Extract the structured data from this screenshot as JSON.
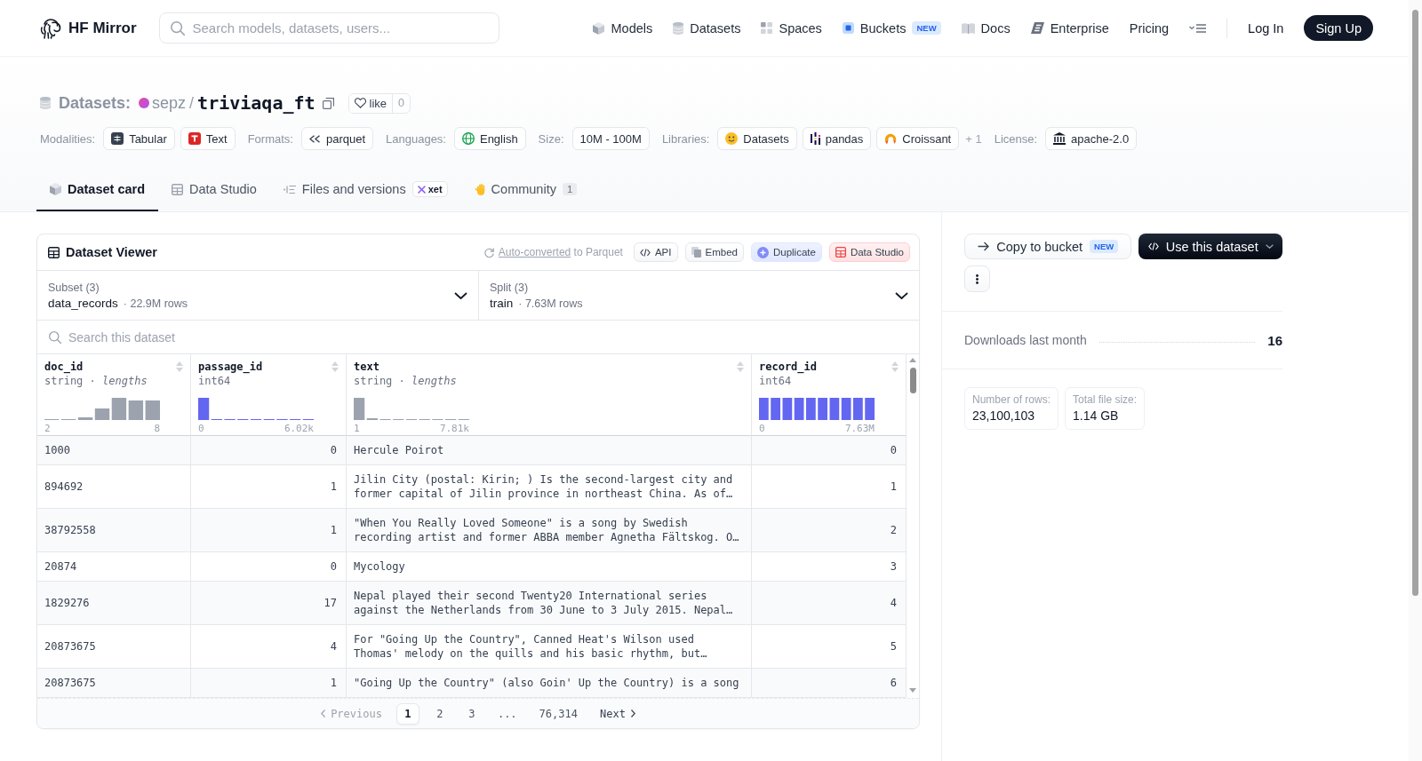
{
  "nav": {
    "brand": "HF Mirror",
    "search": {
      "placeholder": "Search models, datasets, users..."
    },
    "links": [
      {
        "label": "Models"
      },
      {
        "label": "Datasets"
      },
      {
        "label": "Spaces"
      },
      {
        "label": "Buckets",
        "badge": "NEW"
      },
      {
        "label": "Docs"
      },
      {
        "label": "Enterprise"
      },
      {
        "label": "Pricing"
      }
    ],
    "login": "Log In",
    "signup": "Sign Up"
  },
  "dataset_header": {
    "category": "Datasets:",
    "owner": "sepz",
    "separator": "/",
    "name": "triviaqa_ft",
    "like": {
      "label": "like",
      "count": "0"
    }
  },
  "tag_groups": [
    {
      "label": "Modalities:",
      "tags": [
        "Tabular",
        "Text"
      ]
    },
    {
      "label": "Formats:",
      "tags": [
        "parquet"
      ]
    },
    {
      "label": "Languages:",
      "tags": [
        "English"
      ]
    },
    {
      "label": "Size:",
      "tags": [
        "10M - 100M"
      ]
    },
    {
      "label": "Libraries:",
      "tags": [
        "Datasets",
        "pandas",
        "Croissant"
      ],
      "more": "+ 1"
    },
    {
      "label": "License:",
      "tags": [
        "apache-2.0"
      ]
    }
  ],
  "tabs": [
    {
      "label": "Dataset card",
      "selected": true
    },
    {
      "label": "Data Studio",
      "selected": false
    },
    {
      "label": "Files and versions",
      "selected": false,
      "badge": "xet"
    },
    {
      "label": "Community",
      "selected": false,
      "count": "1"
    }
  ],
  "viewer": {
    "title": "Dataset Viewer",
    "conversion": {
      "link": "Auto-converted",
      "text": "to Parquet"
    },
    "buttons": [
      {
        "label": "API",
        "kind": "default"
      },
      {
        "label": "Embed",
        "kind": "default"
      },
      {
        "label": "Duplicate",
        "kind": "duplicate"
      },
      {
        "label": "Data Studio",
        "kind": "studio"
      }
    ],
    "subset": {
      "label": "Subset (3)",
      "value": "data_records",
      "detail": "· 22.9M rows"
    },
    "split": {
      "label": "Split (3)",
      "value": "train",
      "detail": "· 7.63M rows"
    },
    "search": {
      "placeholder": "Search this dataset"
    },
    "table": {
      "columns": [
        {
          "name": "doc_id",
          "type": "string · *lengths*",
          "kind": "string",
          "min": "2",
          "max": "8"
        },
        {
          "name": "passage_id",
          "type": "int64",
          "kind": "number",
          "min": "0",
          "max": "6.02k"
        },
        {
          "name": "text",
          "type": "string · *lengths*",
          "kind": "string",
          "min": "1",
          "max": "7.81k"
        },
        {
          "name": "record_id",
          "type": "int64",
          "kind": "number",
          "min": "0",
          "max": "7.63M"
        }
      ],
      "rows": [
        [
          "1000",
          "0",
          "Hercule Poirot",
          "0"
        ],
        [
          "894692",
          "1",
          "Jilin City (postal: Kirin; ) Is the second-largest city and former capital of Jilin province in northeast China. As of…",
          "1"
        ],
        [
          "38792558",
          "1",
          "\"When You Really Loved Someone\" is a song by Swedish recording artist and former ABBA member Agnetha Fältskog. O…",
          "2"
        ],
        [
          "20874",
          "0",
          "Mycology",
          "3"
        ],
        [
          "1829276",
          "17",
          "Nepal played their second Twenty20 International series against the Netherlands from 30 June to 3 July 2015. Nepal…",
          "4"
        ],
        [
          "20873675",
          "4",
          "For \"Going Up the Country\", Canned Heat's Wilson used Thomas' melody on the quills and his basic rhythm, but…",
          "5"
        ],
        [
          "20873675",
          "1",
          "\"Going Up the Country\" (also Goin' Up the Country) is a song",
          "6"
        ]
      ]
    },
    "pagination": {
      "previous": {
        "label": "Previous",
        "disabled": true
      },
      "pages": [
        {
          "label": "1",
          "selected": true
        },
        {
          "label": "2",
          "selected": false
        },
        {
          "label": "3",
          "selected": false
        }
      ],
      "gap": "...",
      "last": {
        "label": "76,314",
        "selected": false
      },
      "next": {
        "label": "Next",
        "disabled": false
      }
    }
  },
  "sidebar": {
    "copy_button": {
      "label": "Copy to bucket",
      "badge": "NEW"
    },
    "use_button": {
      "label": "Use this dataset"
    },
    "downloads": {
      "label": "Downloads last month",
      "value": "16"
    },
    "stats": [
      {
        "label": "Number of rows:",
        "value": "23,100,103"
      },
      {
        "label": "Total file size:",
        "value": "1.14 GB"
      }
    ]
  }
}
